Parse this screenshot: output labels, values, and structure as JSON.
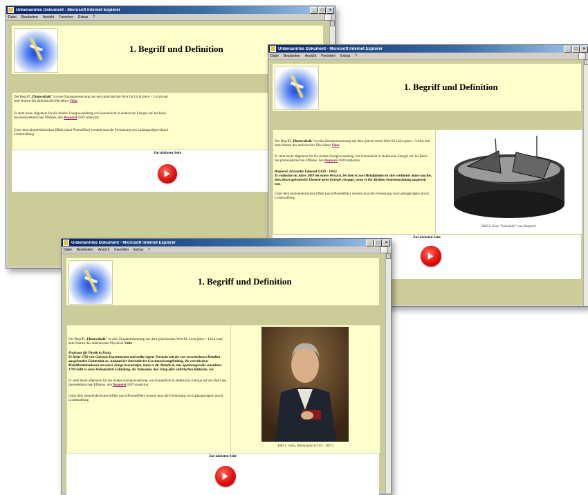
{
  "window": {
    "title": "Unbenanntes Dokument - Microsoft Internet Explorer",
    "menu": [
      "Datei",
      "Bearbeiten",
      "Ansicht",
      "Favoriten",
      "Extras",
      "?"
    ]
  },
  "page": {
    "title": "1. Begriff und Definition",
    "next_label": "Zur nächsten Seite"
  },
  "win1": {
    "p1_pre": "Der Begriff „",
    "p1_term": "Photovoltaik",
    "p1_mid": "“ ist eine Zusammensetzung aus dem griechischen Wort für Licht (phot = Licht) und dem Namen des italienischen Physikers ",
    "p1_link": "Volta",
    "p2_pre": "Er steht heute allgemein für die direkte Energiewandlung von Sonnenlicht in elektrische Energie auf der Basis des photoelektrischen Effektes, den ",
    "p2_link": "Bequerel",
    "p2_post": " 1839 entdeckte.",
    "p3": "Unter dem photoelektrischen Effekt (auch Photoeffekt) versteht man die Freisetzung von Ladungsträgern durch Lichtstrahlung"
  },
  "win2": {
    "p1_pre": "Der Begriff „",
    "p1_term": "Photovoltaik",
    "p1_mid": "“ ist eine Zusammensetzung aus dem griechi-schen Wort für Licht (phot = Licht) und dem Namen des italienischen Phy-sikers ",
    "p1_link": "Volta",
    "p2_pre": "Er steht heute allgemein für die direkte Energiewandlung von Sonnenlicht in elektrische Energie auf der Basis des photoelektrischen Effektes, den ",
    "p2_link": "Bequerel",
    "p2_post": " 1839 entdeckte.",
    "bio_name": "Bequerel, Alexandre Edmond (1820 - 1891)",
    "bio_text": "Er entdeckte im Jahre 1839 bei einem Versuch, bei dem er zwei Metallplatten in eine verdünnte Säure tauchte, dass dieses galvanische Element mehr Energie erzeugte, wenn es der direkten Sonnenstrahlung ausgesetzt war.",
    "p3": "Unter dem photoelektrischen Effekt (auch Photoeffekt) versteht man die Freisetzung von Ladungsträgern durch Lichtstrahlung",
    "caption": "Bild 2: Erste \"Solarzelle\" von Bequerel"
  },
  "win3": {
    "p1_pre": "Der Begriff „",
    "p1_term": "Photovoltaik",
    "p1_mid": "“ ist eine Zusammensetzung aus dem griechischen Wort für Licht (phot = Licht) und dem Namen des italienischen Physikers ",
    "p1_link": "Volta",
    "bio_name": "Professor für Physik in Pavia.",
    "bio_text": "Er hörte 1792 von Galvanis Experimenten und stellte eigene Versuche mit der von verschiedenen Metallen ausgehenden Elektrizität an. Anhand der Intensität der Geschmacksempfindung, die verschiedene Metallkombinationen an seiner Zunge hervorrufen, kann er die Metalle in eine Spannungsreihe einordnen. 1799 stellt er seine bedeutendste Erfindung, die Voltasäule, den Urtyp aller elektrischen Batterien, vor.",
    "p2_pre": "Er steht heute allgemein für die direkte Energiewandlung von Sonnenlicht in elektrische Energie auf der Basis des photoelektrischen Effektes, den ",
    "p2_link": "Bequerel",
    "p2_post": " 1839 entdeckte.",
    "p3": "Unter dem photoelektrischen Effekt (auch Photoeffekt) versteht man die Freisetzung von Ladungsträgern durch Lichtstrahlung",
    "caption": "Bild 1: Volta, Allessandro (1745 - 1827)"
  }
}
